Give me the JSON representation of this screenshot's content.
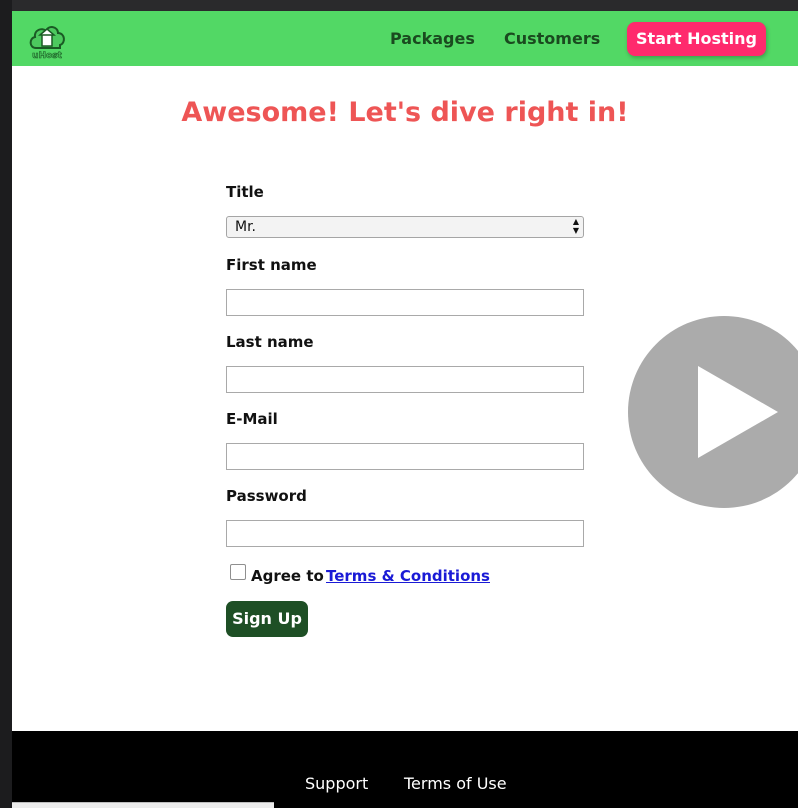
{
  "nav": {
    "logo_text": "uHost",
    "links": [
      "Packages",
      "Customers"
    ],
    "cta_label": "Start Hosting"
  },
  "headline": "Awesome! Let's dive right in!",
  "form": {
    "title_label": "Title",
    "title_value": "Mr.",
    "first_name_label": "First name",
    "first_name_value": "",
    "last_name_label": "Last name",
    "last_name_value": "",
    "email_label": "E-Mail",
    "email_value": "",
    "password_label": "Password",
    "password_value": "",
    "agree_text": "Agree to",
    "terms_link": "Terms & Conditions",
    "agree_checked": false,
    "submit_label": "Sign Up"
  },
  "footer": {
    "links": [
      "Support",
      "Terms of Use"
    ]
  },
  "colors": {
    "navbar": "#52d865",
    "cta": "#ff2a6d",
    "headline": "#ee5555",
    "submit": "#1e4f25",
    "link": "#1a1ad6",
    "footer": "#000000"
  },
  "icons": {
    "logo": "cloud-home-logo-icon",
    "select_arrows": "up-down-arrows-icon",
    "video_overlay": "play-icon"
  }
}
